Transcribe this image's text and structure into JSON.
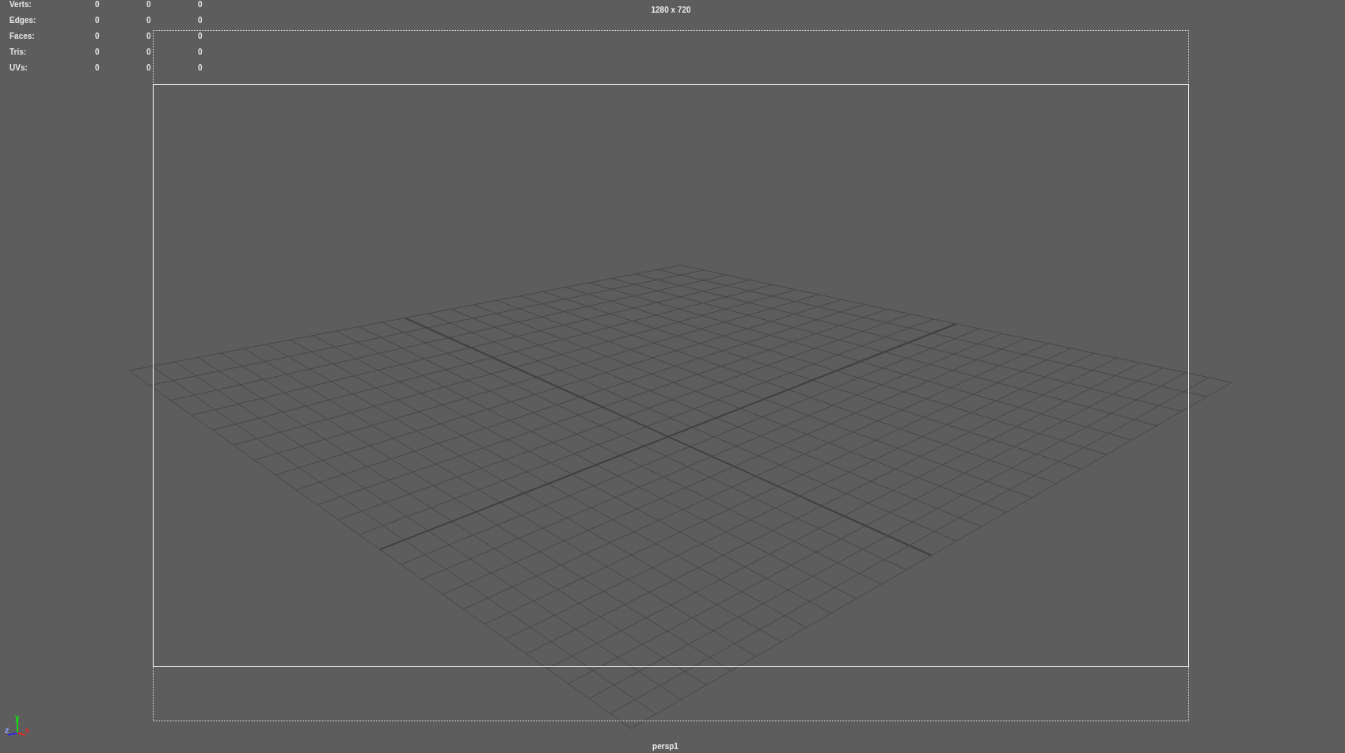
{
  "heads_up": {
    "stats": [
      {
        "label": "Verts:",
        "values": [
          "0",
          "0",
          "0"
        ]
      },
      {
        "label": "Edges:",
        "values": [
          "0",
          "0",
          "0"
        ]
      },
      {
        "label": "Faces:",
        "values": [
          "0",
          "0",
          "0"
        ]
      },
      {
        "label": "Tris:",
        "values": [
          "0",
          "0",
          "0"
        ]
      },
      {
        "label": "UVs:",
        "values": [
          "0",
          "0",
          "0"
        ]
      }
    ]
  },
  "resolution": "1280 x 720",
  "camera": "persp1",
  "axis_gizmo": {
    "x": "x",
    "y": "y",
    "z": "z"
  }
}
